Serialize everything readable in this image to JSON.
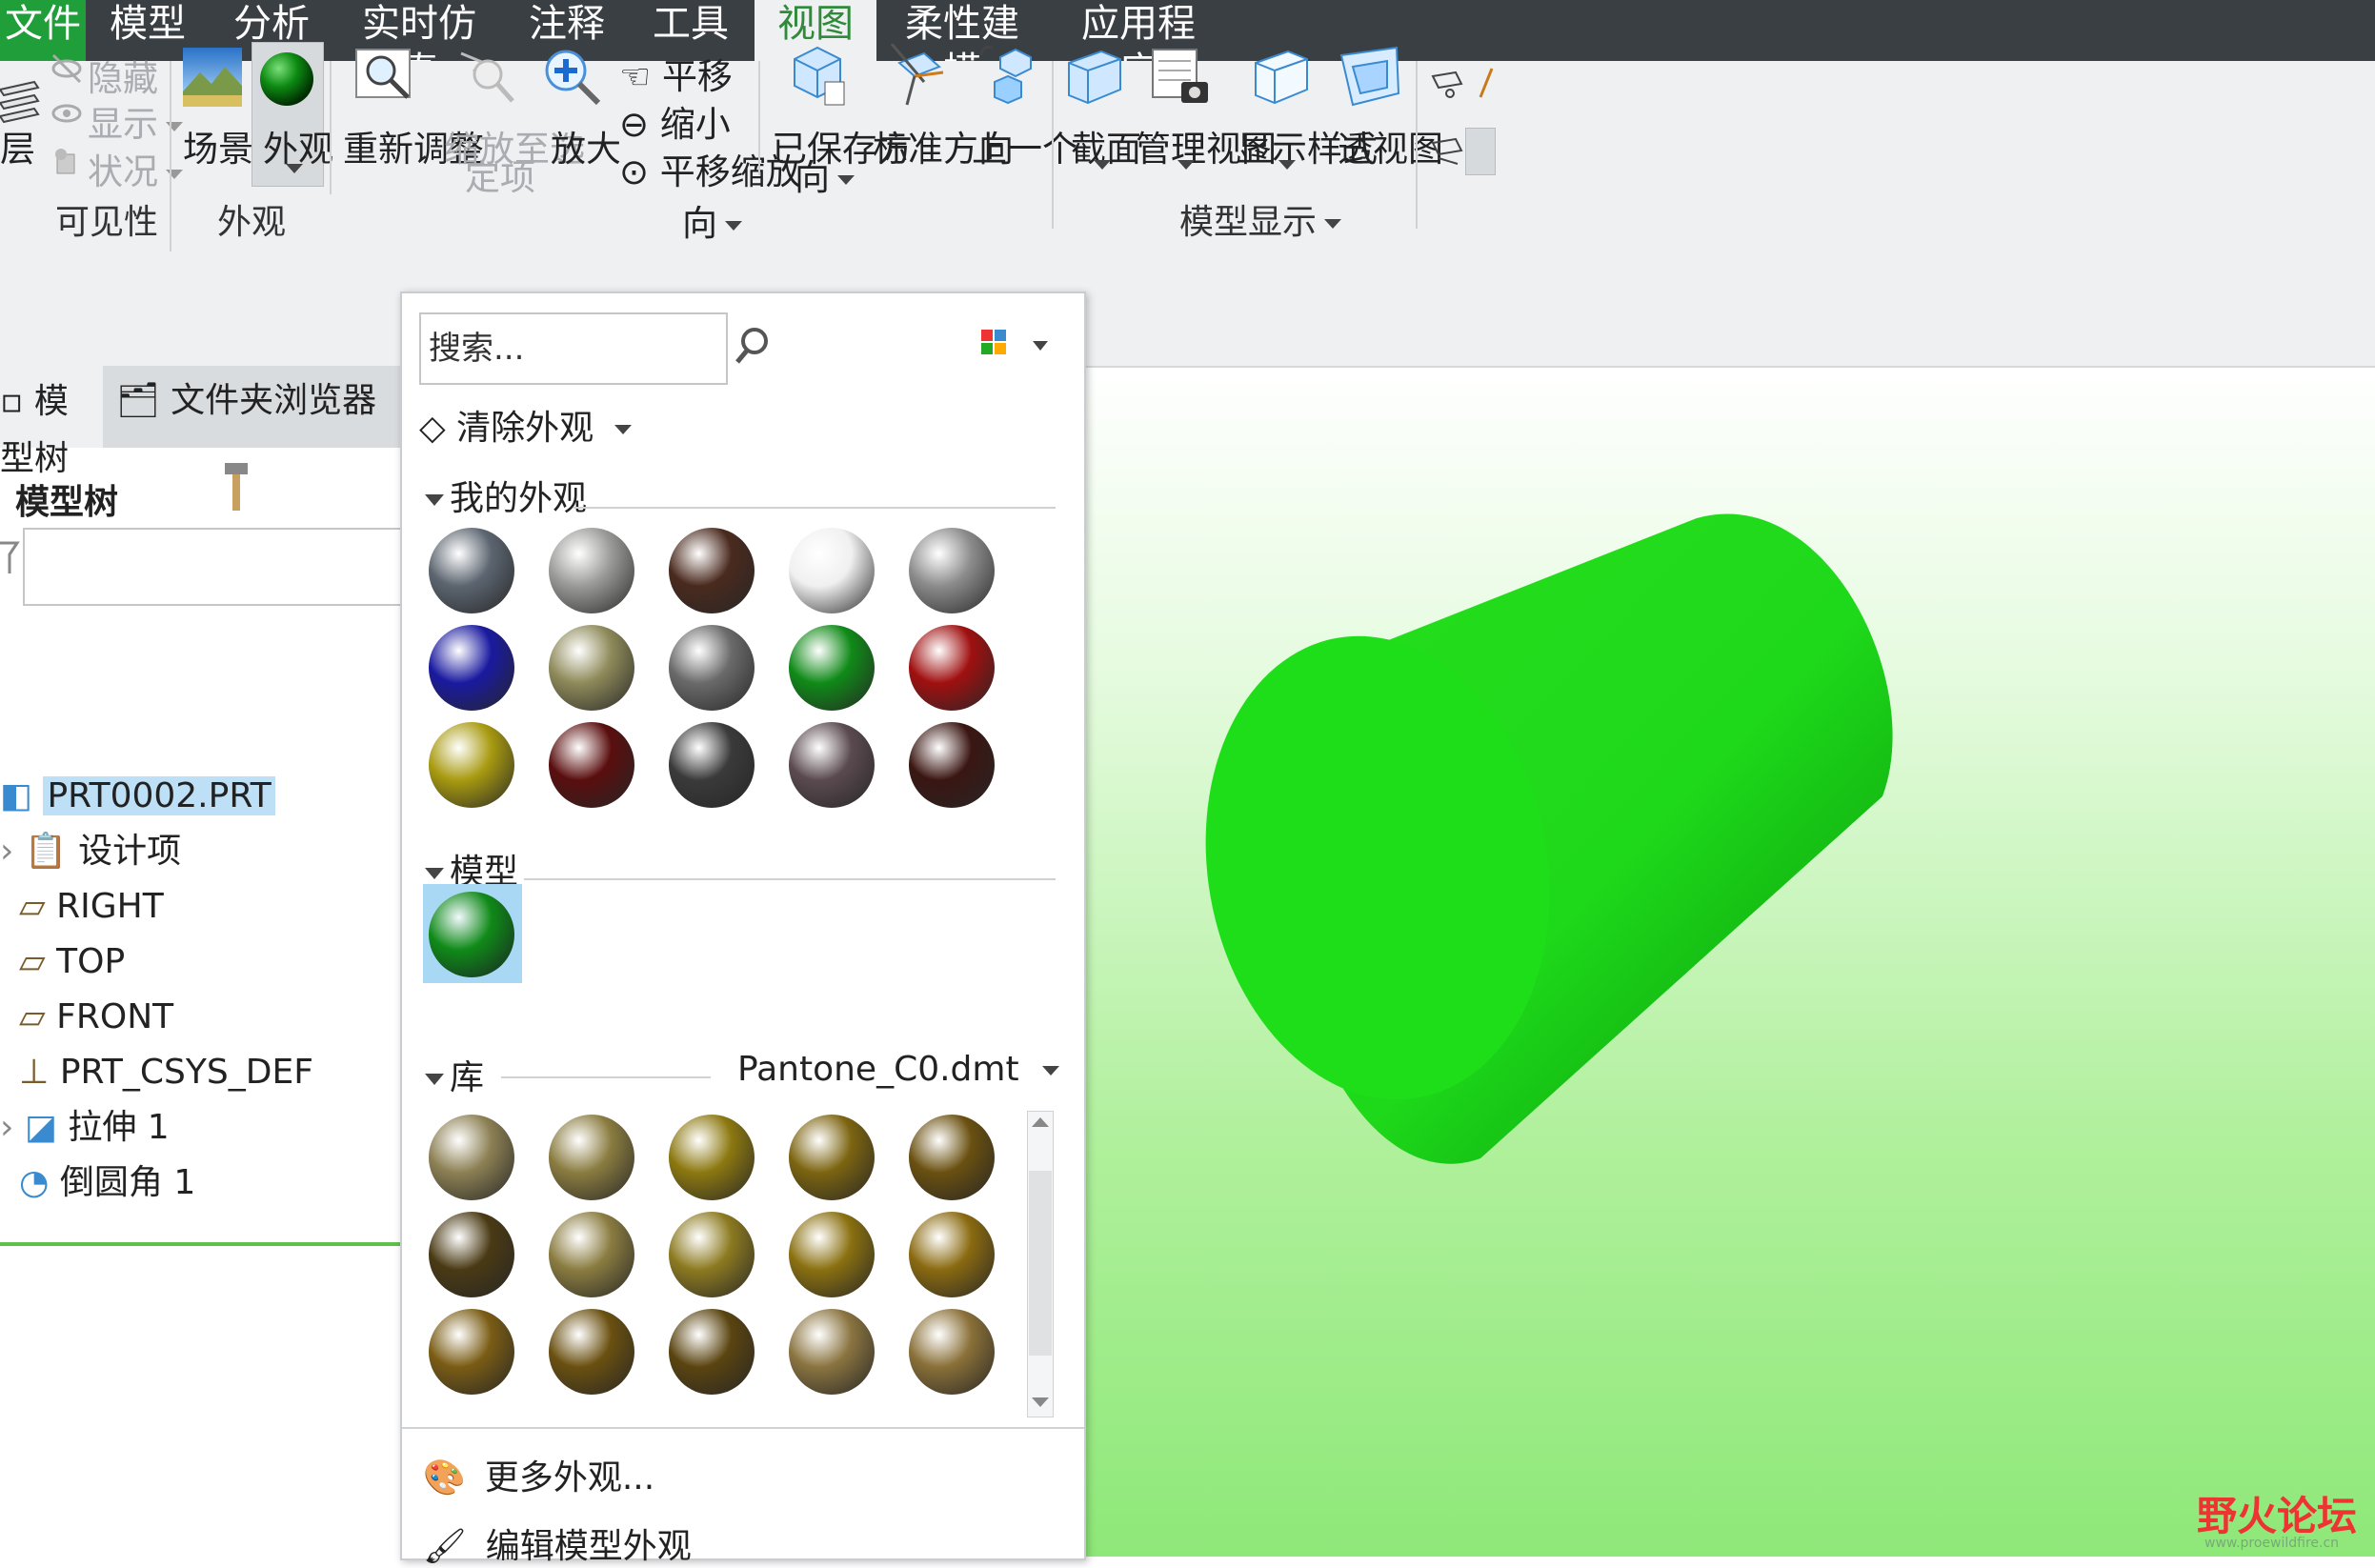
{
  "menu": {
    "tabs": [
      "文件",
      "模型",
      "分析",
      "实时仿真",
      "注释",
      "工具",
      "视图",
      "柔性建模",
      "应用程序"
    ],
    "active": "视图"
  },
  "ribbon": {
    "visibility": {
      "layers_label": "层",
      "hide_label": "隐藏",
      "show_label": "显示",
      "status_label": "状况",
      "group_label": "可见性"
    },
    "appearance": {
      "scene_label": "场景",
      "appearance_label": "外观",
      "group_label": "外观"
    },
    "orientation": {
      "refit_label": "重新调整",
      "zoom_selected_label_1": "缩放至选",
      "zoom_selected_label_2": "定项",
      "zoom_in_label": "放大",
      "pan_label": "平移",
      "zoom_out_label": "缩小",
      "pan_zoom_label": "平移缩放",
      "saved_orient_label_1": "已保存方",
      "saved_orient_label_2": "向",
      "standard_orient_label": "标准方向",
      "previous_label": "上一个",
      "group_label": "方向"
    },
    "model_display": {
      "section_label": "截面",
      "view_manager_label": "管理视图",
      "display_style_label": "显示样式",
      "perspective_label": "透视图",
      "group_label": "模型显示"
    }
  },
  "left_panel": {
    "tab_model_tree": "模型树",
    "tab_folder_browser": "文件夹浏览器",
    "header": "模型树",
    "items": [
      {
        "label": "PRT0002.PRT",
        "selected": true
      },
      {
        "label": "设计项"
      },
      {
        "label": "RIGHT"
      },
      {
        "label": "TOP"
      },
      {
        "label": "FRONT"
      },
      {
        "label": "PRT_CSYS_DEF"
      },
      {
        "label": "拉伸 1"
      },
      {
        "label": "倒圆角 1"
      }
    ]
  },
  "appearance_gallery": {
    "search_placeholder": "搜索...",
    "clear_label": "清除外观",
    "my_appearances_label": "我的外观",
    "model_label": "模型",
    "library_label": "库",
    "library_file": "Pantone_C0.dmt",
    "more_label": "更多外观...",
    "edit_label": "编辑模型外观",
    "my_colors": [
      "#5c6570",
      "#9a9a98",
      "#4a2a1e",
      "#f0f0f0",
      "#8c8c8c",
      "#1a1aa0",
      "#8e8a5a",
      "#6a6a6a",
      "#108a18",
      "#a01010",
      "#a89a10",
      "#5a0e0e",
      "#3a3a3a",
      "#5a4a50",
      "#3a1612"
    ],
    "model_colors": [
      "#108a18"
    ],
    "library_colors": [
      "#8c8054",
      "#8a7c40",
      "#8c7810",
      "#7c6410",
      "#6a5010",
      "#4a3a14",
      "#8a7c40",
      "#8c7a20",
      "#8a7010",
      "#8a6a10",
      "#7a5c14",
      "#6a5010",
      "#5a4410",
      "#8a7440",
      "#8a7038"
    ]
  },
  "viewport": {
    "model_color": "#1ed81a",
    "watermark": "野火论坛",
    "watermark_url": "www.proewildfire.cn"
  }
}
